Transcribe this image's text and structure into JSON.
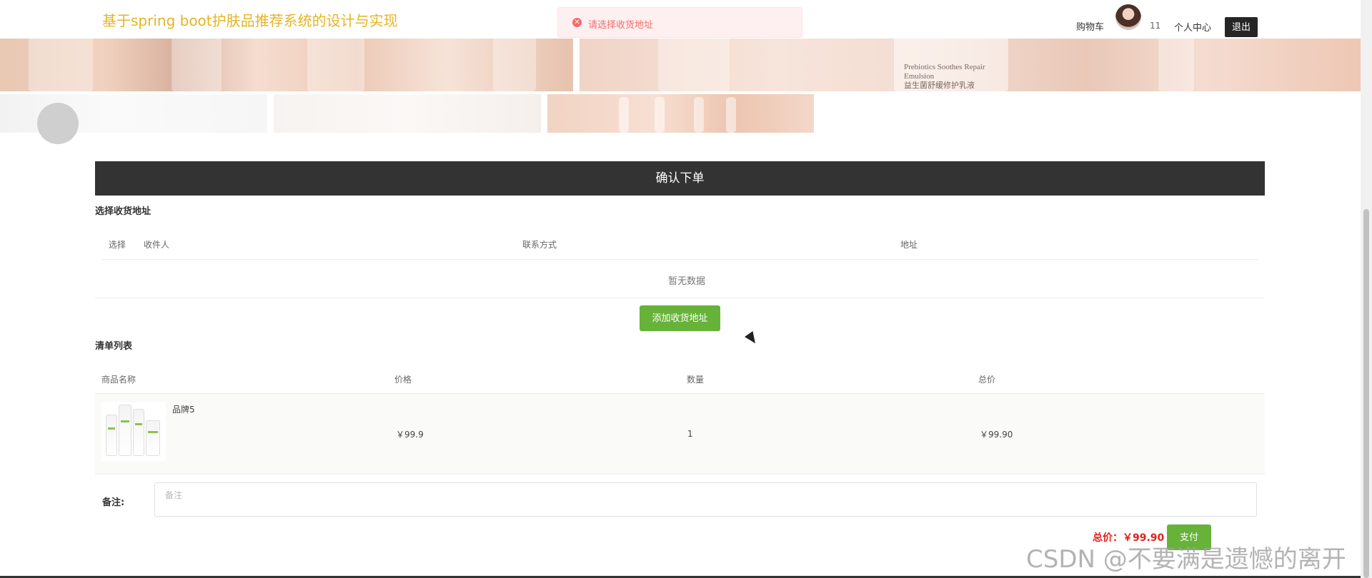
{
  "header": {
    "site_title": "基于spring boot护肤品推荐系统的设计与实现",
    "cart_label": "购物车",
    "username": "11",
    "profile_label": "个人中心",
    "logout_label": "退出"
  },
  "banner": {
    "product_text_line1": "Prebiotics Soothes Repair",
    "product_text_line2": "Emulsion",
    "product_text_line3": "益生菌舒缓修护乳液"
  },
  "toast": {
    "type": "error",
    "message": "请选择收货地址"
  },
  "order": {
    "title": "确认下单",
    "address_section_title": "选择收货地址",
    "address_columns": [
      "选择",
      "收件人",
      "联系方式",
      "地址"
    ],
    "address_empty_text": "暂无数据",
    "add_address_label": "添加收货地址",
    "list_section_title": "清单列表",
    "list_columns": [
      "商品名称",
      "价格",
      "数量",
      "总价"
    ],
    "items": [
      {
        "name": "品牌5",
        "price": "￥99.9",
        "quantity": "1",
        "total": "￥99.90"
      }
    ],
    "remark_label": "备注:",
    "remark_placeholder": "备注",
    "total_label": "总价：￥99.90",
    "pay_label": "支付"
  },
  "watermark": "CSDN @不要满是遗憾的离开",
  "colors": {
    "accent_green": "#67b33a",
    "title_yellow": "#e6b422",
    "error_red": "#f56c6c",
    "price_red": "#e4201c",
    "dark_bar": "#333333"
  }
}
